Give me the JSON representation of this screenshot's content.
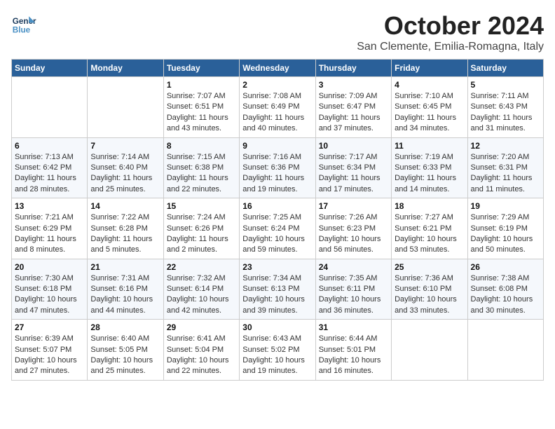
{
  "header": {
    "logo_line1": "General",
    "logo_line2": "Blue",
    "month": "October 2024",
    "location": "San Clemente, Emilia-Romagna, Italy"
  },
  "days_of_week": [
    "Sunday",
    "Monday",
    "Tuesday",
    "Wednesday",
    "Thursday",
    "Friday",
    "Saturday"
  ],
  "weeks": [
    [
      {
        "day": "",
        "info": ""
      },
      {
        "day": "",
        "info": ""
      },
      {
        "day": "1",
        "info": "Sunrise: 7:07 AM\nSunset: 6:51 PM\nDaylight: 11 hours and 43 minutes."
      },
      {
        "day": "2",
        "info": "Sunrise: 7:08 AM\nSunset: 6:49 PM\nDaylight: 11 hours and 40 minutes."
      },
      {
        "day": "3",
        "info": "Sunrise: 7:09 AM\nSunset: 6:47 PM\nDaylight: 11 hours and 37 minutes."
      },
      {
        "day": "4",
        "info": "Sunrise: 7:10 AM\nSunset: 6:45 PM\nDaylight: 11 hours and 34 minutes."
      },
      {
        "day": "5",
        "info": "Sunrise: 7:11 AM\nSunset: 6:43 PM\nDaylight: 11 hours and 31 minutes."
      }
    ],
    [
      {
        "day": "6",
        "info": "Sunrise: 7:13 AM\nSunset: 6:42 PM\nDaylight: 11 hours and 28 minutes."
      },
      {
        "day": "7",
        "info": "Sunrise: 7:14 AM\nSunset: 6:40 PM\nDaylight: 11 hours and 25 minutes."
      },
      {
        "day": "8",
        "info": "Sunrise: 7:15 AM\nSunset: 6:38 PM\nDaylight: 11 hours and 22 minutes."
      },
      {
        "day": "9",
        "info": "Sunrise: 7:16 AM\nSunset: 6:36 PM\nDaylight: 11 hours and 19 minutes."
      },
      {
        "day": "10",
        "info": "Sunrise: 7:17 AM\nSunset: 6:34 PM\nDaylight: 11 hours and 17 minutes."
      },
      {
        "day": "11",
        "info": "Sunrise: 7:19 AM\nSunset: 6:33 PM\nDaylight: 11 hours and 14 minutes."
      },
      {
        "day": "12",
        "info": "Sunrise: 7:20 AM\nSunset: 6:31 PM\nDaylight: 11 hours and 11 minutes."
      }
    ],
    [
      {
        "day": "13",
        "info": "Sunrise: 7:21 AM\nSunset: 6:29 PM\nDaylight: 11 hours and 8 minutes."
      },
      {
        "day": "14",
        "info": "Sunrise: 7:22 AM\nSunset: 6:28 PM\nDaylight: 11 hours and 5 minutes."
      },
      {
        "day": "15",
        "info": "Sunrise: 7:24 AM\nSunset: 6:26 PM\nDaylight: 11 hours and 2 minutes."
      },
      {
        "day": "16",
        "info": "Sunrise: 7:25 AM\nSunset: 6:24 PM\nDaylight: 10 hours and 59 minutes."
      },
      {
        "day": "17",
        "info": "Sunrise: 7:26 AM\nSunset: 6:23 PM\nDaylight: 10 hours and 56 minutes."
      },
      {
        "day": "18",
        "info": "Sunrise: 7:27 AM\nSunset: 6:21 PM\nDaylight: 10 hours and 53 minutes."
      },
      {
        "day": "19",
        "info": "Sunrise: 7:29 AM\nSunset: 6:19 PM\nDaylight: 10 hours and 50 minutes."
      }
    ],
    [
      {
        "day": "20",
        "info": "Sunrise: 7:30 AM\nSunset: 6:18 PM\nDaylight: 10 hours and 47 minutes."
      },
      {
        "day": "21",
        "info": "Sunrise: 7:31 AM\nSunset: 6:16 PM\nDaylight: 10 hours and 44 minutes."
      },
      {
        "day": "22",
        "info": "Sunrise: 7:32 AM\nSunset: 6:14 PM\nDaylight: 10 hours and 42 minutes."
      },
      {
        "day": "23",
        "info": "Sunrise: 7:34 AM\nSunset: 6:13 PM\nDaylight: 10 hours and 39 minutes."
      },
      {
        "day": "24",
        "info": "Sunrise: 7:35 AM\nSunset: 6:11 PM\nDaylight: 10 hours and 36 minutes."
      },
      {
        "day": "25",
        "info": "Sunrise: 7:36 AM\nSunset: 6:10 PM\nDaylight: 10 hours and 33 minutes."
      },
      {
        "day": "26",
        "info": "Sunrise: 7:38 AM\nSunset: 6:08 PM\nDaylight: 10 hours and 30 minutes."
      }
    ],
    [
      {
        "day": "27",
        "info": "Sunrise: 6:39 AM\nSunset: 5:07 PM\nDaylight: 10 hours and 27 minutes."
      },
      {
        "day": "28",
        "info": "Sunrise: 6:40 AM\nSunset: 5:05 PM\nDaylight: 10 hours and 25 minutes."
      },
      {
        "day": "29",
        "info": "Sunrise: 6:41 AM\nSunset: 5:04 PM\nDaylight: 10 hours and 22 minutes."
      },
      {
        "day": "30",
        "info": "Sunrise: 6:43 AM\nSunset: 5:02 PM\nDaylight: 10 hours and 19 minutes."
      },
      {
        "day": "31",
        "info": "Sunrise: 6:44 AM\nSunset: 5:01 PM\nDaylight: 10 hours and 16 minutes."
      },
      {
        "day": "",
        "info": ""
      },
      {
        "day": "",
        "info": ""
      }
    ]
  ]
}
